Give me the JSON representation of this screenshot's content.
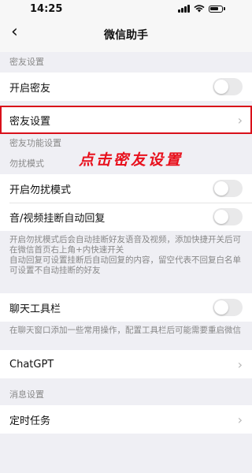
{
  "status_bar": {
    "time": "14:25"
  },
  "nav": {
    "title": "微信助手"
  },
  "sections": {
    "close_friend_header": "密友设置",
    "close_friend_toggle_label": "开启密友",
    "close_friend_settings_label": "密友设置",
    "close_friend_features_header": "密友功能设置",
    "dnd_header": "勿扰模式",
    "dnd_toggle_label": "开启勿扰模式",
    "auto_reply_label": "音/视频挂断自动回复",
    "dnd_desc_line1": "开启勿扰模式后会自动挂断好友语音及视频，添加快捷开关后可在微信首页右上角+内快速开关",
    "dnd_desc_line2": "自动回复可设置挂断后自动回复的内容，留空代表不回复白名单可设置不自动挂断的好友",
    "toolbar_label": "聊天工具栏",
    "toolbar_desc": "在聊天窗口添加一些常用操作，配置工具栏后可能需要重启微信",
    "chatgpt_label": "ChatGPT",
    "message_header": "消息设置",
    "scheduled_label": "定时任务"
  },
  "toggles": {
    "close_friend": false,
    "dnd": false,
    "auto_reply": false,
    "toolbar": false
  },
  "annotation": {
    "text": "点击密友设置",
    "color": "#e8101c"
  },
  "colors": {
    "highlight": "#d9101a",
    "background": "#efeff4"
  }
}
